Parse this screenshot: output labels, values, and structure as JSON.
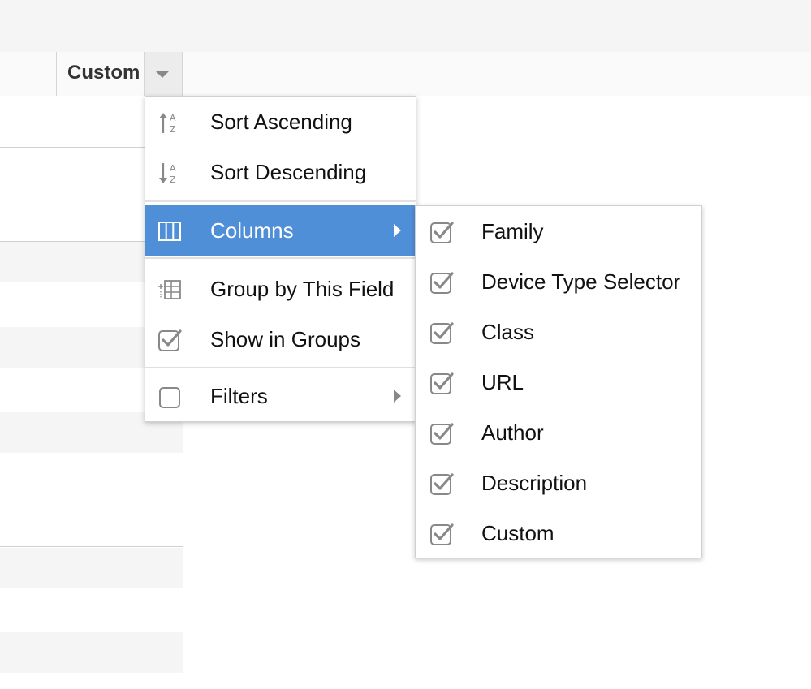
{
  "header": {
    "column_label": "Custom"
  },
  "column_menu": {
    "items": [
      {
        "label": "Sort Ascending",
        "icon": "sort-ascending-icon"
      },
      {
        "label": "Sort Descending",
        "icon": "sort-descending-icon"
      },
      {
        "label": "Columns",
        "icon": "columns-icon",
        "active": true,
        "has_submenu": true
      },
      {
        "label": "Group by This Field",
        "icon": "group-by-icon"
      },
      {
        "label": "Show in Groups",
        "icon": "checkbox-checked-icon",
        "checked": true
      },
      {
        "label": "Filters",
        "icon": "checkbox-unchecked-icon",
        "checked": false,
        "has_submenu": true
      }
    ]
  },
  "columns_submenu": {
    "items": [
      {
        "label": "Family",
        "checked": true
      },
      {
        "label": "Device Type Selector",
        "checked": true
      },
      {
        "label": "Class",
        "checked": true
      },
      {
        "label": "URL",
        "checked": true
      },
      {
        "label": "Author",
        "checked": true
      },
      {
        "label": "Description",
        "checked": true
      },
      {
        "label": "Custom",
        "checked": true
      }
    ]
  },
  "colors": {
    "active_item": "#4f8fd8",
    "icon_gray": "#888888"
  }
}
